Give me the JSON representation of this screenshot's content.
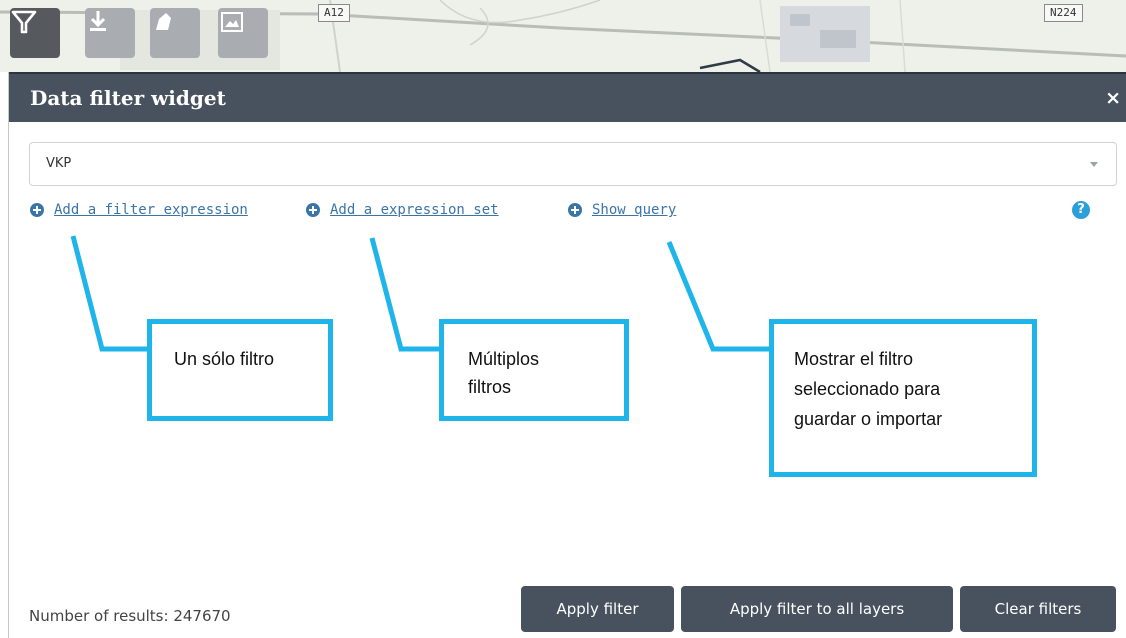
{
  "map": {
    "road_labels": [
      "A12",
      "N224"
    ]
  },
  "toolbar": {
    "tools": [
      {
        "icon": "filter-icon",
        "state": "active"
      },
      {
        "icon": "download-icon",
        "state": "inactive"
      },
      {
        "icon": "shape-icon",
        "state": "inactive"
      },
      {
        "icon": "image-icon",
        "state": "inactive"
      }
    ]
  },
  "panel": {
    "title": "Data filter widget",
    "close_label": "×"
  },
  "layer_select": {
    "value": "VKP"
  },
  "actions": {
    "add_filter_expression": "Add a filter expression",
    "add_expression_set": "Add a expression set",
    "show_query": "Show query",
    "help_label": "?"
  },
  "annotations": {
    "single_filter_text": "Un sólo filtro",
    "multiple_filters_line1": "Múltiplos",
    "multiple_filters_line2": "filtros",
    "show_query_line1": "Mostrar el filtro",
    "show_query_line2": "seleccionado para",
    "show_query_line3": "guardar o importar",
    "accent_color": "#1fb4ea"
  },
  "footer": {
    "results_label": "Number of results: 247670",
    "apply_filter": "Apply filter",
    "apply_filter_all": "Apply filter to all layers",
    "clear_filters": "Clear filters"
  },
  "colors": {
    "header_bg": "#47525e",
    "link": "#3a75a8",
    "help": "#2a9fd8"
  }
}
